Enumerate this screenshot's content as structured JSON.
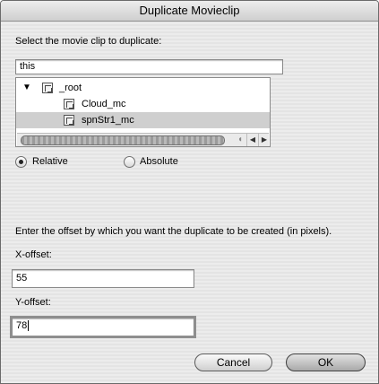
{
  "dialog": {
    "title": "Duplicate Movieclip",
    "instruction": "Select the movie clip to duplicate:",
    "path_value": "this"
  },
  "tree": {
    "disclosure_icon": "triangle-down",
    "root_label": "_root",
    "children": [
      {
        "label": "Cloud_mc",
        "selected": false
      },
      {
        "label": "spnStr1_mc",
        "selected": true
      }
    ]
  },
  "mode": {
    "options": [
      {
        "label": "Relative",
        "selected": true
      },
      {
        "label": "Absolute",
        "selected": false
      }
    ]
  },
  "offset": {
    "instruction": "Enter the offset by which you want the duplicate to be created (in pixels).",
    "x_label": "X-offset:",
    "x_value": "55",
    "y_label": "Y-offset:",
    "y_value": "78"
  },
  "buttons": {
    "cancel": "Cancel",
    "ok": "OK"
  }
}
